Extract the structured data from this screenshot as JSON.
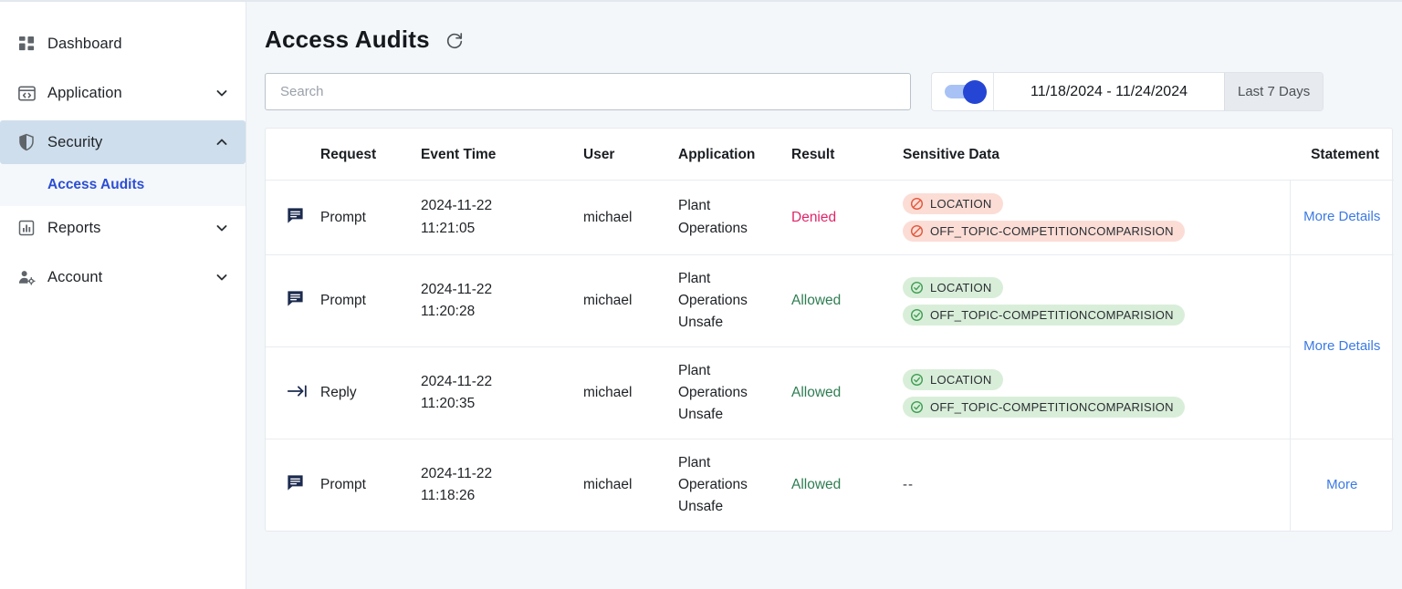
{
  "sidebar": {
    "items": [
      {
        "label": "Dashboard",
        "icon": "dashboard-icon",
        "expandable": false,
        "active": false
      },
      {
        "label": "Application",
        "icon": "application-icon",
        "expandable": true,
        "active": false,
        "chevron": "chevron-down-icon"
      },
      {
        "label": "Security",
        "icon": "shield-icon",
        "expandable": true,
        "active": true,
        "chevron": "chevron-up-icon"
      },
      {
        "label": "Reports",
        "icon": "bar-chart-icon",
        "expandable": true,
        "active": false,
        "chevron": "chevron-down-icon"
      },
      {
        "label": "Account",
        "icon": "account-icon",
        "expandable": true,
        "active": false,
        "chevron": "chevron-down-icon"
      }
    ],
    "submenu": {
      "parent": "Security",
      "label": "Access Audits",
      "active": true
    }
  },
  "header": {
    "title": "Access Audits",
    "refresh_icon": "refresh-icon"
  },
  "search": {
    "value": "",
    "placeholder": "Search"
  },
  "daterange": {
    "toggle_on": true,
    "range_label": "11/18/2024 - 11/24/2024",
    "preset_label": "Last 7 Days"
  },
  "table": {
    "columns": [
      "",
      "Request",
      "Event Time",
      "User",
      "Application",
      "Result",
      "Sensitive Data",
      "Statement"
    ],
    "rows": [
      {
        "icon": "prompt-message-icon",
        "request": "Prompt",
        "date": "2024-11-22",
        "time": "11:21:05",
        "user": "michael",
        "application": [
          "Plant",
          "Operations"
        ],
        "result": "Denied",
        "result_state": "denied",
        "sensitive_data": [
          {
            "label": "LOCATION",
            "state": "denied"
          },
          {
            "label": "OFF_TOPIC-COMPETITIONCOMPARISION",
            "state": "denied"
          }
        ],
        "statement": "More Details"
      },
      {
        "icon": "prompt-message-icon",
        "request": "Prompt",
        "date": "2024-11-22",
        "time": "11:20:28",
        "user": "michael",
        "application": [
          "Plant",
          "Operations",
          "Unsafe"
        ],
        "result": "Allowed",
        "result_state": "allowed",
        "sensitive_data": [
          {
            "label": "LOCATION",
            "state": "allowed"
          },
          {
            "label": "OFF_TOPIC-COMPETITIONCOMPARISION",
            "state": "allowed"
          }
        ],
        "statement": "More Details",
        "statement_rowspan": 2
      },
      {
        "icon": "reply-arrow-icon",
        "request": "Reply",
        "date": "2024-11-22",
        "time": "11:20:35",
        "user": "michael",
        "application": [
          "Plant",
          "Operations",
          "Unsafe"
        ],
        "result": "Allowed",
        "result_state": "allowed",
        "sensitive_data": [
          {
            "label": "LOCATION",
            "state": "allowed"
          },
          {
            "label": "OFF_TOPIC-COMPETITIONCOMPARISION",
            "state": "allowed"
          }
        ],
        "statement": null
      },
      {
        "icon": "prompt-message-icon",
        "request": "Prompt",
        "date": "2024-11-22",
        "time": "11:18:26",
        "user": "michael",
        "application": [
          "Plant",
          "Operations",
          "Unsafe"
        ],
        "result": "Allowed",
        "result_state": "allowed",
        "sensitive_data": [],
        "empty_placeholder": "--",
        "statement": "More"
      }
    ]
  },
  "colors": {
    "accent_blue": "#2c4ed4",
    "link_blue": "#3b7ae4",
    "denied_text": "#e0256a",
    "allowed_text": "#2e7d52",
    "badge_deny_bg": "#fbddd6",
    "badge_allow_bg": "#d9eed9",
    "sidebar_active_bg": "#cfdeec",
    "page_bg": "#f3f7fa"
  }
}
